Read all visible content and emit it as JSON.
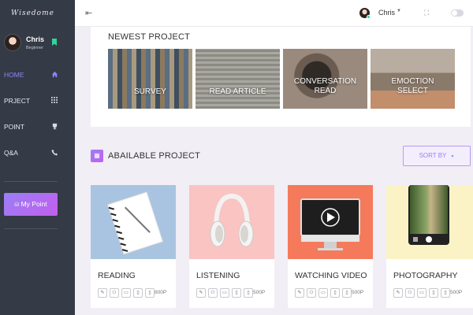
{
  "app": {
    "logo": "Wisedome"
  },
  "user": {
    "name": "Chris",
    "role": "Beginner"
  },
  "nav": [
    {
      "label": "HOME",
      "icon": "home-icon",
      "active": true
    },
    {
      "label": "PRJECT",
      "icon": "grid-icon",
      "active": false
    },
    {
      "label": "POINT",
      "icon": "trophy-icon",
      "active": false
    },
    {
      "label": "Q&A",
      "icon": "phone-icon",
      "active": false
    }
  ],
  "my_point": {
    "label": "My Point"
  },
  "topbar": {
    "user_name": "Chris"
  },
  "newest": {
    "title": "NEWEST PROJECT",
    "items": [
      {
        "line1": "SURVEY",
        "line2": ""
      },
      {
        "line1": "READ ARTICLE",
        "line2": ""
      },
      {
        "line1": "CONVERSATION",
        "line2": "READ"
      },
      {
        "line1": "EMOCTION",
        "line2": "SELECT"
      }
    ]
  },
  "available": {
    "title": "ABAILABLE PROJECT",
    "sort_label": "SORT BY",
    "cards": [
      {
        "title": "READING",
        "points": "800P"
      },
      {
        "title": "LISTENING",
        "points": "500P"
      },
      {
        "title": "WATCHING VIDEO",
        "points": "500P"
      },
      {
        "title": "PHOTOGRAPHY",
        "points": "500P"
      }
    ]
  },
  "colors": {
    "sidebar": "#343a46",
    "accent": "#9b7ef4",
    "active_nav": "#8f84f5",
    "online": "#31d39a"
  }
}
